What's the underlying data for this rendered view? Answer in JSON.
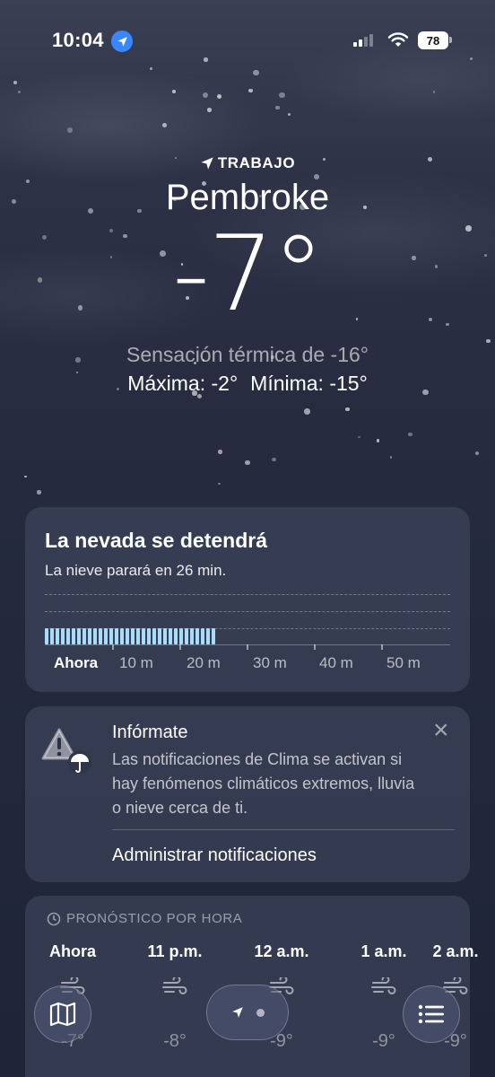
{
  "status_bar": {
    "time": "10:04",
    "battery": "78"
  },
  "header": {
    "location_label": "TRABAJO",
    "city": "Pembroke",
    "temperature": "-7°",
    "feels_like": "Sensación térmica de -16°",
    "max": "Máxima: -2°",
    "min": "Mínima: -15°"
  },
  "snow_card": {
    "title": "La nevada se detendrá",
    "subtitle": "La nieve parará en 26 min.",
    "axis_labels": [
      "Ahora",
      "10 m",
      "20 m",
      "30 m",
      "40 m",
      "50 m"
    ],
    "bar_color": "#a8dcf7"
  },
  "info_card": {
    "title": "Infórmate",
    "body": "Las notificaciones de Clima se activan si hay fenómenos climáticos extremos, lluvia o nieve cerca de ti.",
    "action": "Administrar notificaciones",
    "close_icon": "close-icon",
    "warning_icon": "warning-umbrella-icon"
  },
  "hourly": {
    "header": "PRONÓSTICO POR HORA",
    "items": [
      {
        "label": "Ahora",
        "icon": "snow-wind-icon",
        "temp": "-7°"
      },
      {
        "label": "11 p.m.",
        "icon": "wind-icon",
        "temp": "-8°"
      },
      {
        "label": "12 a.m.",
        "icon": "wind-icon",
        "temp": "-9°"
      },
      {
        "label": "1 a.m.",
        "icon": "wind-icon",
        "temp": "-9°"
      },
      {
        "label": "2 a.m.",
        "icon": "wind-icon",
        "temp": "-9°"
      }
    ]
  },
  "toolbar": {
    "map_icon": "map-icon",
    "location_icon": "location-arrow-icon",
    "list_icon": "list-icon"
  }
}
